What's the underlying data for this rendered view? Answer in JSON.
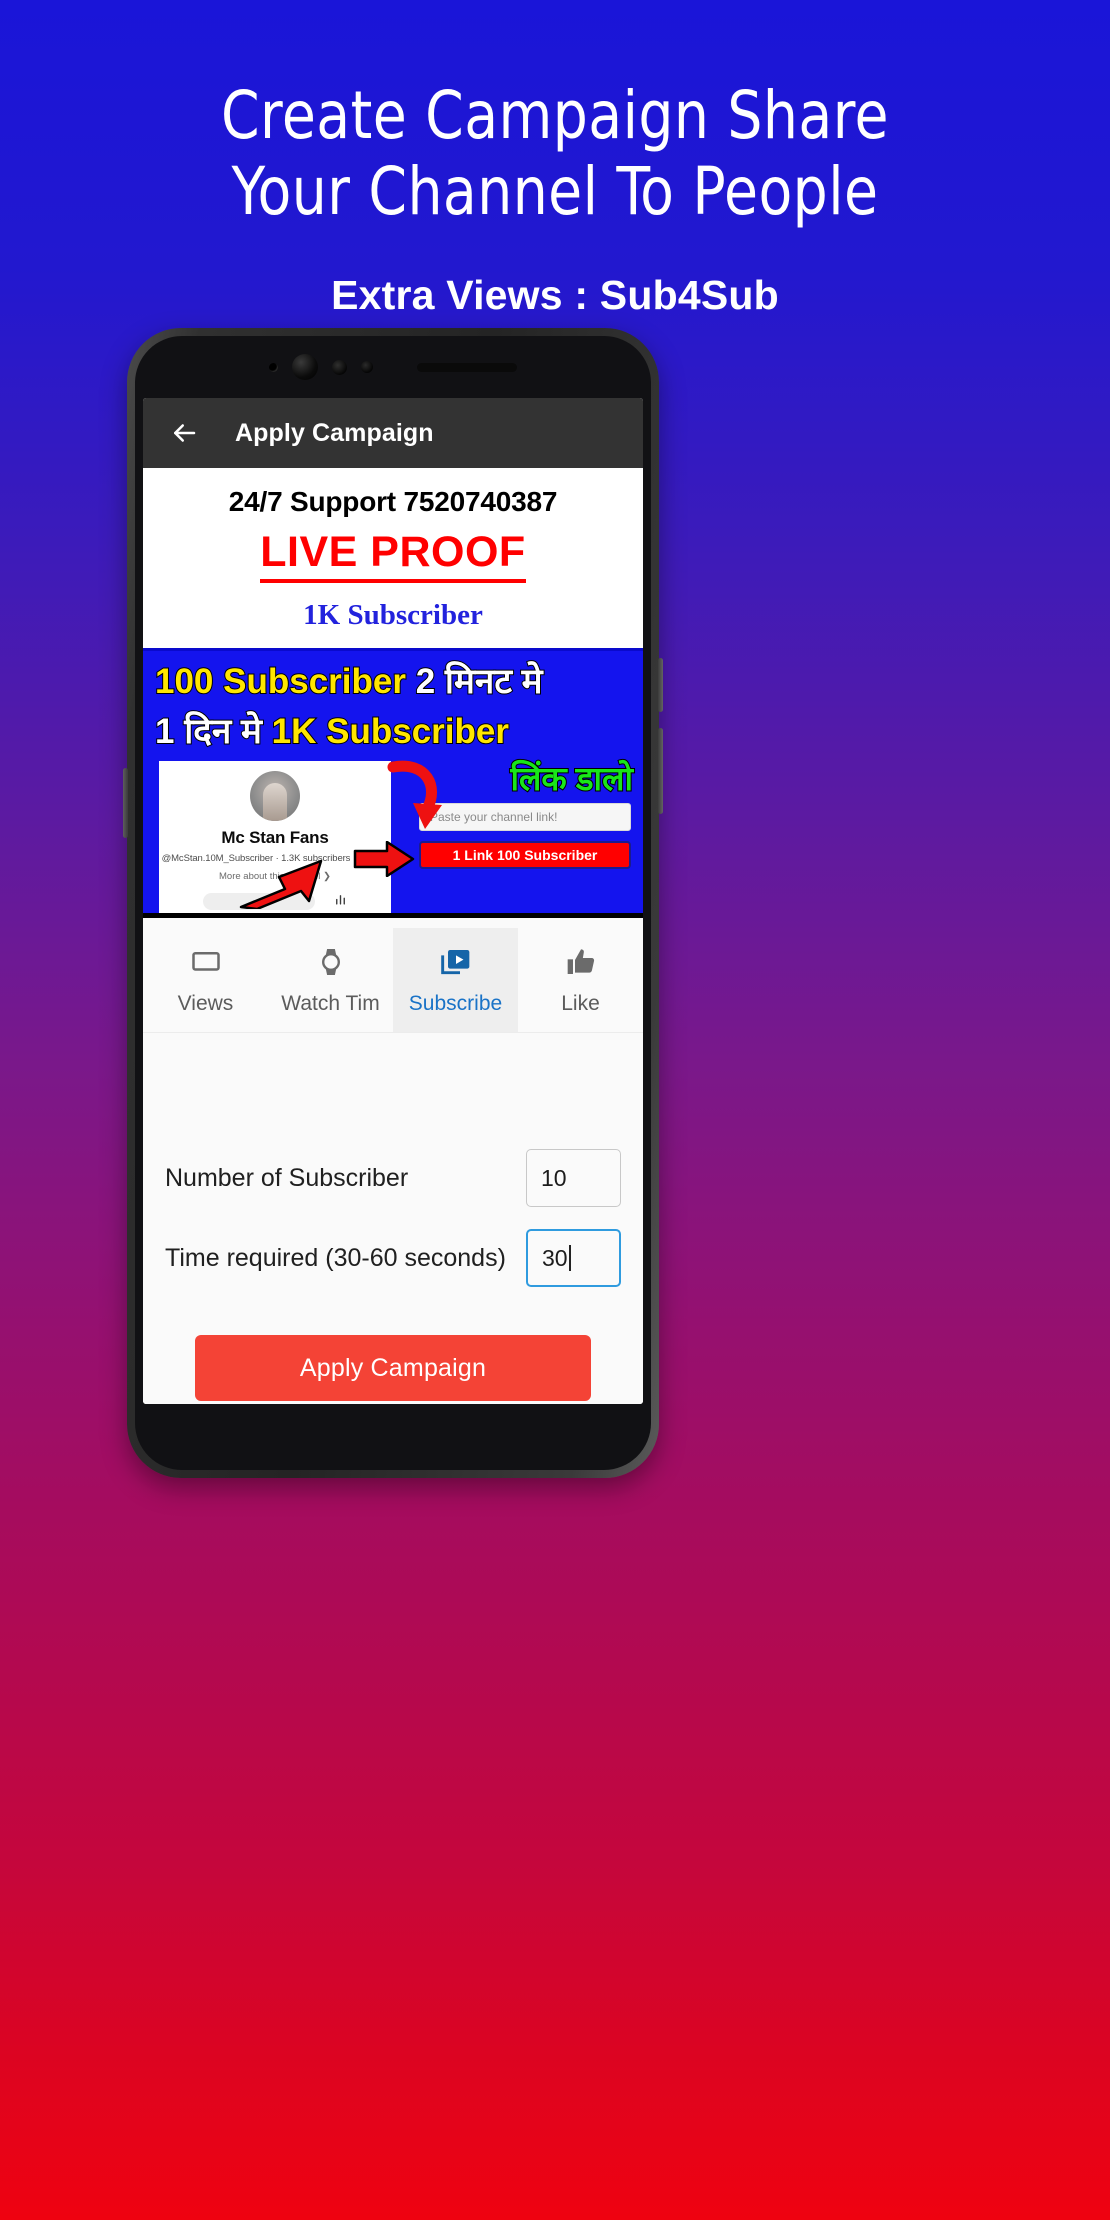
{
  "promo": {
    "title": "Create Campaign Share\nYour Channel To People",
    "subtitle": "Extra Views : Sub4Sub"
  },
  "app": {
    "appbar": {
      "back_icon": "arrow-left-icon",
      "title": "Apply Campaign"
    },
    "banner": {
      "support_line": "24/7 Support 7520740387",
      "live_proof": "LIVE PROOF",
      "subscriber_line": "1K Subscriber"
    },
    "thumbnail": {
      "row1_a": "100 Subscriber ",
      "row1_b": "2 मिनट मे",
      "row2_a": "1 दिन मे ",
      "row2_b": "1K Subscriber",
      "green_text": "लिंक डालो",
      "channel_card": {
        "name": "Mc Stan Fans",
        "meta": "@McStan.10M_Subscriber · 1.3K subscribers · 1 video",
        "more": "More about this channel  ❯",
        "analytics_icon": "bar-chart-icon"
      },
      "paste_placeholder": "Paste your channel link!",
      "link_button": "1 Link 100 Subscriber"
    },
    "tabs": [
      {
        "label": "Views",
        "icon": "monitor-icon",
        "selected": false
      },
      {
        "label": "Watch Tim",
        "icon": "watch-icon",
        "selected": false
      },
      {
        "label": "Subscribe",
        "icon": "video-library-icon",
        "selected": true
      },
      {
        "label": "Like",
        "icon": "thumb-up-icon",
        "selected": false
      }
    ],
    "form": {
      "subscriber_label": "Number of Subscriber",
      "subscriber_value": "10",
      "time_label": "Time required (30-60 seconds)",
      "time_value": "30",
      "apply_button": "Apply Campaign"
    },
    "colors": {
      "appbar_bg": "#333333",
      "accent_blue": "#1a73c7",
      "apply_red": "#f44336",
      "live_proof_red": "#ff0000",
      "subscriber_blue": "#2222dd"
    }
  }
}
